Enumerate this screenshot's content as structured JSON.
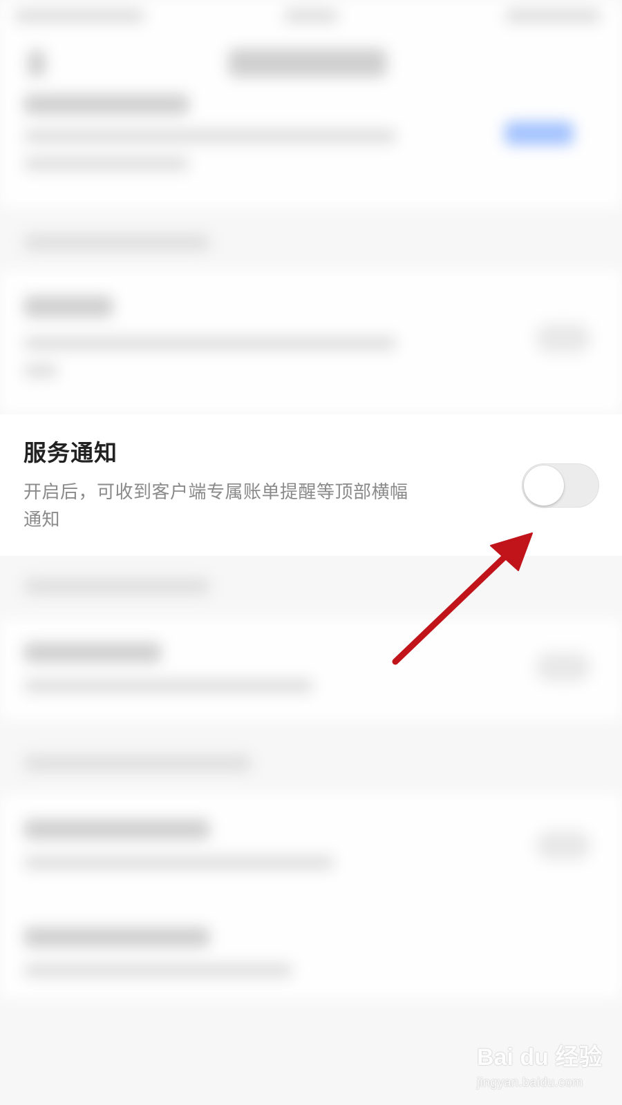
{
  "settings": {
    "service_notification": {
      "title": "服务通知",
      "description": "开启后，可收到客户端专属账单提醒等顶部横幅通知",
      "toggle_on": false
    }
  },
  "watermark": {
    "brand": "Bai du 经验",
    "site": "jingyan.baidu.com"
  },
  "colors": {
    "arrow": "#c0141a",
    "toggle_track": "#ececec",
    "toggle_knob": "#ffffff"
  }
}
